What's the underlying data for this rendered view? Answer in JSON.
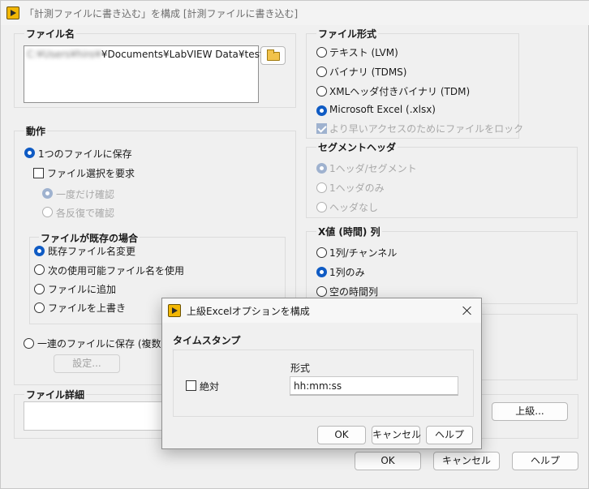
{
  "window": {
    "title": "「計測ファイルに書き込む」を構成 [計測ファイルに書き込む]"
  },
  "file_name": {
    "label": "ファイル名",
    "path_blurred": "C:¥Users¥hiro¥",
    "path_visible": "¥Documents¥LabVIEW Data¥test.xlsx",
    "browse_icon": "folder-open-icon"
  },
  "action": {
    "label": "動作",
    "save_single": "1つのファイルに保存",
    "ask_user": "ファイル選択を要求",
    "ask_once": "一度だけ確認",
    "ask_each": "各反復で確認",
    "if_exists": {
      "label": "ファイルが既存の場合",
      "options": [
        "既存ファイル名変更",
        "次の使用可能ファイル名を使用",
        "ファイルに追加",
        "ファイルを上書き"
      ]
    },
    "save_series": "一連のファイルに保存 (複数ファイ",
    "settings_button": "設定..."
  },
  "file_format": {
    "label": "ファイル形式",
    "options": [
      "テキスト (LVM)",
      "バイナリ (TDMS)",
      "XMLヘッダ付きバイナリ (TDM)",
      "Microsoft Excel (.xlsx)"
    ],
    "lock_option": "より早いアクセスのためにファイルをロック"
  },
  "segment_header": {
    "label": "セグメントヘッダ",
    "options": [
      "1ヘッダ/セグメント",
      "1ヘッダのみ",
      "ヘッダなし"
    ]
  },
  "x_value": {
    "label": "X値 (時間) 列",
    "options": [
      "1列/チャンネル",
      "1列のみ",
      "空の時間列"
    ]
  },
  "file_details": {
    "label": "ファイル詳細"
  },
  "advanced_button": "上級...",
  "buttons": {
    "ok": "OK",
    "cancel": "キャンセル",
    "help": "ヘルプ"
  },
  "dialog": {
    "title": "上級Excelオプションを構成",
    "timestamp_label": "タイムスタンプ",
    "format_label": "形式",
    "absolute_label": "絶対",
    "format_value": "hh:mm:ss",
    "ok": "OK",
    "cancel": "キャンセル",
    "help": "ヘルプ"
  },
  "colors": {
    "accent": "#0f5bc4",
    "disabled_accent": "#9fb2cf",
    "disabled_text": "#a8a8a8"
  }
}
